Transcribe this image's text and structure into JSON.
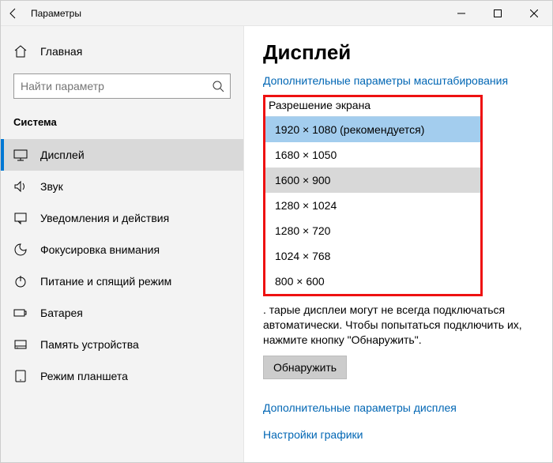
{
  "titlebar": {
    "title": "Параметры"
  },
  "sidebar": {
    "home_label": "Главная",
    "search_placeholder": "Найти параметр",
    "section_title": "Система",
    "items": [
      {
        "label": "Дисплей",
        "icon": "display-icon",
        "active": true
      },
      {
        "label": "Звук",
        "icon": "sound-icon",
        "active": false
      },
      {
        "label": "Уведомления и действия",
        "icon": "notifications-icon",
        "active": false
      },
      {
        "label": "Фокусировка внимания",
        "icon": "focus-icon",
        "active": false
      },
      {
        "label": "Питание и спящий режим",
        "icon": "power-icon",
        "active": false
      },
      {
        "label": "Батарея",
        "icon": "battery-icon",
        "active": false
      },
      {
        "label": "Память устройства",
        "icon": "storage-icon",
        "active": false
      },
      {
        "label": "Режим планшета",
        "icon": "tablet-icon",
        "active": false
      }
    ]
  },
  "content": {
    "page_title": "Дисплей",
    "scaling_link": "Дополнительные параметры масштабирования",
    "resolution_label": "Разрешение экрана",
    "resolution_options": [
      "1920 × 1080 (рекомендуется)",
      "1680 × 1050",
      "1600 × 900",
      "1280 × 1024",
      "1280 × 720",
      "1024 × 768",
      "800 × 600"
    ],
    "selected_index": 0,
    "hover_index": 2,
    "detect_text_partial": ". тарые дисплеи могут не всегда подключаться автоматически. Чтобы попытаться подключить их, нажмите кнопку \"Обнаружить\".",
    "detect_button": "Обнаружить",
    "adv_display_link": "Дополнительные параметры дисплея",
    "graphics_link": "Настройки графики"
  }
}
